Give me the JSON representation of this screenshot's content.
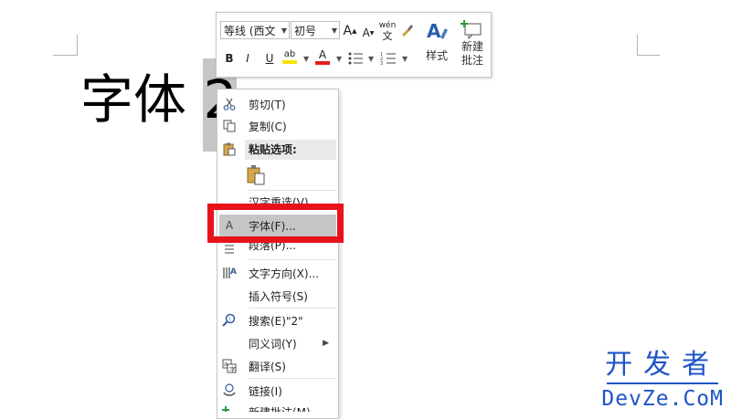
{
  "document": {
    "text_before": "字体 ",
    "selected_text": "2",
    "paragraph_mark": "↓"
  },
  "mini_toolbar": {
    "font_name": "等线 (西文",
    "font_size": "初号",
    "grow_font": "A",
    "shrink_font": "A",
    "phonetic_top": "wén",
    "phonetic_bottom": "文",
    "bold": "B",
    "italic": "I",
    "underline": "U",
    "highlight": "ab",
    "font_color": "A",
    "styles_label": "样式",
    "new_comment_label_1": "新建",
    "new_comment_label_2": "批注",
    "highlight_color": "#f7e400",
    "font_color_swatch": "#e31b1b"
  },
  "context_menu": {
    "items": [
      {
        "label": "剪切(T)",
        "icon": "scissors-icon"
      },
      {
        "label": "复制(C)",
        "icon": "copy-icon"
      },
      {
        "label": "粘贴选项:",
        "icon": "clipboard-icon"
      },
      {
        "label": "汉字重选(V)",
        "icon": ""
      },
      {
        "label": "字体(F)...",
        "icon": "font-icon",
        "icon_glyph": "A"
      },
      {
        "label": "段落(P)...",
        "icon": "paragraph-icon"
      },
      {
        "label": "文字方向(X)...",
        "icon": "text-direction-icon"
      },
      {
        "label": "插入符号(S)",
        "icon": ""
      },
      {
        "label": "搜索(E)\"2\"",
        "icon": "search-icon"
      },
      {
        "label": "同义词(Y)",
        "icon": ""
      },
      {
        "label": "翻译(S)",
        "icon": "translate-icon"
      },
      {
        "label": "链接(I)",
        "icon": "link-icon"
      },
      {
        "label": "新建批注(M)",
        "icon": "new-comment-icon"
      }
    ]
  },
  "watermark": {
    "cn": "开发者",
    "en": "DevZe.CoM"
  },
  "colors": {
    "highlight_box": "#e8121b",
    "watermark": "#1f55c7",
    "menu_hover": "#c5c5c5"
  }
}
